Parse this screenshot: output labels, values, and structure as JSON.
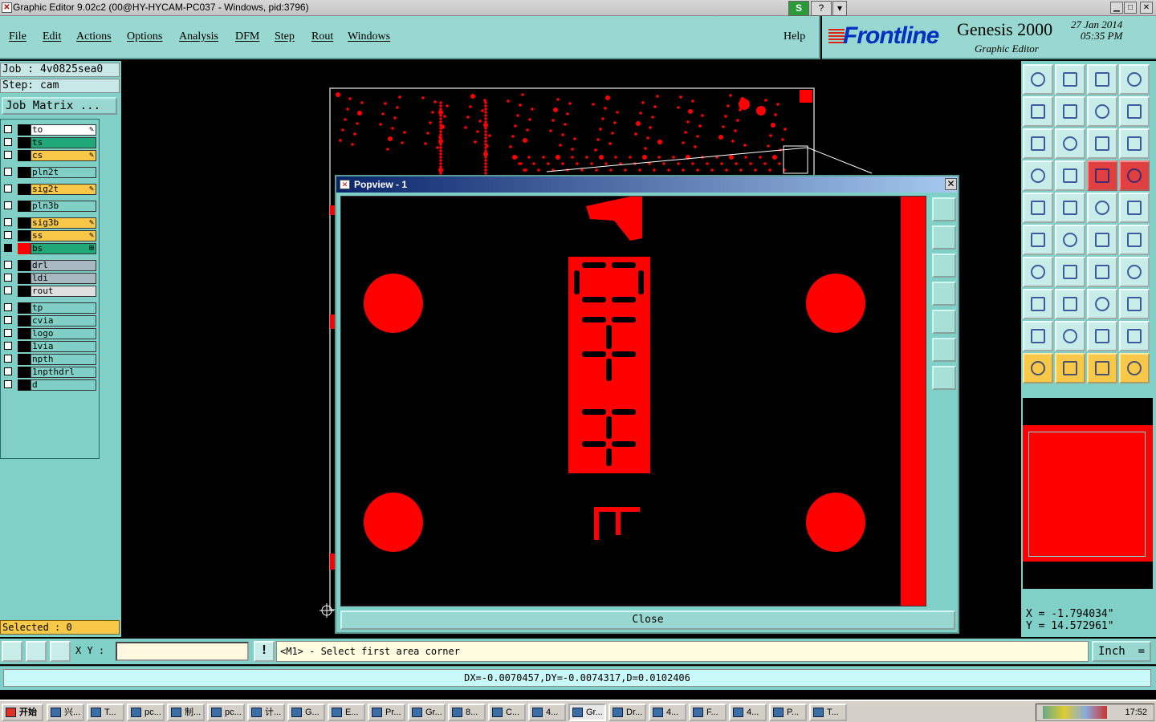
{
  "window": {
    "title": "Graphic Editor 9.02c2 (00@HY-HYCAM-PC037 - Windows, pid:3796)",
    "min_label": "▁",
    "max_label": "□",
    "close_label": "✕",
    "s_label": "S",
    "q_label": "?",
    "menu_arrow": "▾"
  },
  "menubar": {
    "items": [
      {
        "label": "File"
      },
      {
        "label": "Edit"
      },
      {
        "label": "Actions"
      },
      {
        "label": "Options"
      },
      {
        "label": "Analysis"
      },
      {
        "label": "DFM"
      },
      {
        "label": "Step"
      },
      {
        "label": "Rout"
      },
      {
        "label": "Windows"
      }
    ],
    "help": "Help"
  },
  "brand": {
    "logo": "Frontline",
    "product": "Genesis 2000",
    "subtitle": "Graphic Editor",
    "date": "27 Jan 2014",
    "time": "05:35 PM"
  },
  "job": {
    "job_label": "Job : 4v0825sea0",
    "step_label": "Step: cam",
    "matrix_button": "Job Matrix ..."
  },
  "layers": [
    {
      "name": "to",
      "color": "#ffffff",
      "swatch": "#000000",
      "mark": "✎"
    },
    {
      "name": "ts",
      "color": "#20a878",
      "swatch": "#000000",
      "mark": ""
    },
    {
      "name": "cs",
      "color": "#f8c848",
      "swatch": "#000000",
      "mark": "✎"
    },
    {
      "name": "pln2t",
      "color": "#80d0c8",
      "swatch": "#000000",
      "mark": ""
    },
    {
      "name": "sig2t",
      "color": "#f8c848",
      "swatch": "#000000",
      "mark": "✎"
    },
    {
      "name": "pln3b",
      "color": "#80d0c8",
      "swatch": "#000000",
      "mark": ""
    },
    {
      "name": "sig3b",
      "color": "#f8c848",
      "swatch": "#000000",
      "mark": "✎"
    },
    {
      "name": "ss",
      "color": "#f8c848",
      "swatch": "#000000",
      "mark": "✎"
    },
    {
      "name": "bs",
      "color": "#20a878",
      "swatch": "#ff0000",
      "mark": "⊞",
      "active": true
    },
    {
      "name": "drl",
      "color": "#a8b8c0",
      "swatch": "#000000",
      "mark": ""
    },
    {
      "name": "ldi",
      "color": "#a8b8c0",
      "swatch": "#000000",
      "mark": ""
    },
    {
      "name": "rout",
      "color": "#e0e0e0",
      "swatch": "#000000",
      "mark": ""
    },
    {
      "name": "tp",
      "color": "#80d0c8",
      "swatch": "#000000",
      "mark": ""
    },
    {
      "name": "cvia",
      "color": "#80d0c8",
      "swatch": "#000000",
      "mark": ""
    },
    {
      "name": "logo",
      "color": "#80d0c8",
      "swatch": "#000000",
      "mark": ""
    },
    {
      "name": "1via",
      "color": "#80d0c8",
      "swatch": "#000000",
      "mark": ""
    },
    {
      "name": "npth",
      "color": "#80d0c8",
      "swatch": "#000000",
      "mark": ""
    },
    {
      "name": "1npthdrl",
      "color": "#80d0c8",
      "swatch": "#000000",
      "mark": ""
    },
    {
      "name": "d",
      "color": "#80d0c8",
      "swatch": "#000000",
      "mark": ""
    }
  ],
  "selected_label": "Selected : 0",
  "popup": {
    "title": "Popview - 1",
    "close_button": "Close"
  },
  "coords": {
    "x": "X = -1.794034\"",
    "y": "Y = 14.572961\""
  },
  "cmdbar": {
    "xy_label": "X Y :",
    "xy_value": "",
    "alert": "!",
    "prompt": "<M1> - Select first area corner",
    "unit": "Inch",
    "unit_arrow": "="
  },
  "status": "DX=-0.0070457,DY=-0.0074317,D=0.0102406",
  "taskbar": {
    "start": "开始",
    "tasks": [
      "兴...",
      "T...",
      "pc...",
      "制...",
      "pc...",
      "计...",
      "G...",
      "E...",
      "Pr...",
      "Gr...",
      "8...",
      "C...",
      "4...",
      "Gr...",
      "Dr...",
      "4...",
      "F...",
      "4...",
      "P...",
      "T..."
    ],
    "clock": "17:52"
  }
}
